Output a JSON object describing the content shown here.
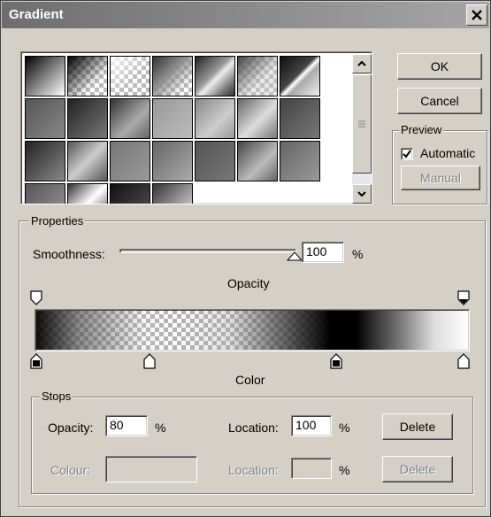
{
  "window": {
    "title": "Gradient"
  },
  "buttons": {
    "ok": "OK",
    "cancel": "Cancel",
    "manual": "Manual",
    "delete": "Delete",
    "delete_color": "Delete"
  },
  "preview": {
    "group_label": "Preview",
    "automatic_label": "Automatic",
    "automatic_checked": true
  },
  "properties": {
    "group_label": "Properties",
    "smoothness_label": "Smoothness:",
    "smoothness_value": "100",
    "smoothness_unit": "%",
    "smoothness_fraction": 1.0
  },
  "gradient_bar": {
    "opacity_label": "Opacity",
    "color_label": "Color"
  },
  "stops": {
    "group_label": "Stops",
    "opacity_label": "Opacity:",
    "opacity_value": "80",
    "opacity_unit": "%",
    "location_label": "Location:",
    "location_value": "100",
    "location_unit": "%",
    "colour_label": "Colour:",
    "colour_location_label": "Location:",
    "colour_location_value": "",
    "colour_location_unit": "%"
  },
  "icons": [
    "close-icon",
    "scroll-up-icon",
    "scroll-down-icon",
    "checkmark-icon"
  ]
}
